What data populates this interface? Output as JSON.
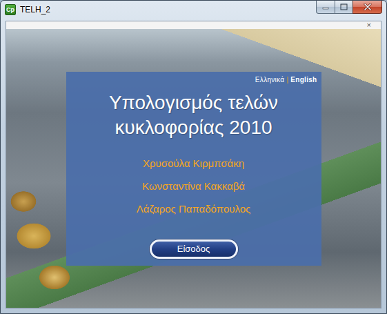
{
  "window": {
    "title": "TELH_2",
    "icon_text": "Cp"
  },
  "close_mark": "×",
  "languages": [
    {
      "label": "Ελληνικά",
      "selected": false
    },
    {
      "label": "English",
      "selected": true
    }
  ],
  "language_separator": "|",
  "title": "Υπολογισμός τελών κυκλοφορίας 2010",
  "authors": [
    "Χρυσούλα Κιρμπσάκη",
    "Κωνσταντίνα Κακκαβά",
    "Λάζαρος Παπαδόπουλος"
  ],
  "enter_button": "Είσοδος"
}
